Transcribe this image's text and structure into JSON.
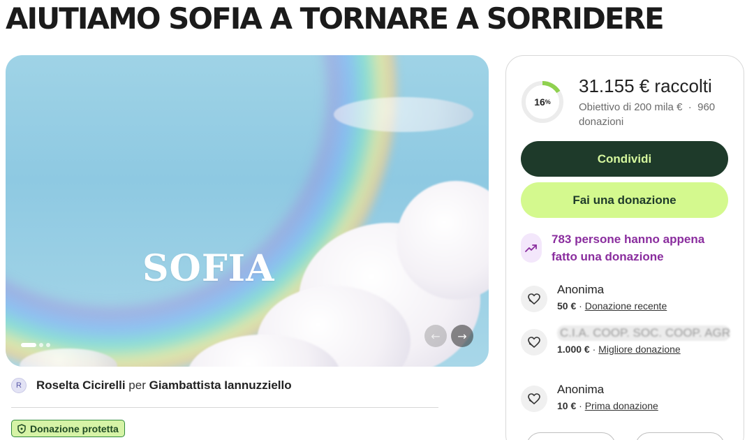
{
  "page": {
    "title": "AIUTIAMO SOFIA A TORNARE A SORRIDERE"
  },
  "hero": {
    "image_text": "SOFIA",
    "slide_count": 3,
    "active_slide": 1,
    "prev_icon": "arrow-left-icon",
    "next_icon": "arrow-right-icon",
    "prev_glyph": "←",
    "next_glyph": "→"
  },
  "organizer": {
    "avatar_initial": "R",
    "organizer_name": "Roselta Cicirelli",
    "connector": "per",
    "beneficiary_name": "Giambattista Iannuzziello"
  },
  "protection": {
    "label": "Donazione protetta",
    "icon": "shield-icon"
  },
  "donation_card": {
    "progress_percent": 16,
    "progress_label": "16",
    "progress_suffix": "%",
    "raised": "31.155 € raccolti",
    "goal": "Obiettivo di 200 mila €",
    "separator": "·",
    "donations_count": "960 donazioni",
    "share_label": "Condividi",
    "donate_label": "Fai una donazione",
    "trend_icon": "trending-up-icon",
    "trend_text": "783 persone hanno appena fatto una donazione",
    "colors": {
      "dark_green": "#1e3a2a",
      "lime": "#d4f98e",
      "purple": "#8a2d9e",
      "progress": "#8fd14f"
    },
    "donors": [
      {
        "name": "Anonima",
        "amount": "50 €",
        "sep": "·",
        "tag": "Donazione recente",
        "icon": "heart-hand-icon"
      },
      {
        "name": "C.I.A. COOP. SOC. COOP. AGRICOLA",
        "amount": "1.000 €",
        "sep": "·",
        "tag": "Migliore donazione",
        "icon": "heart-hand-icon"
      },
      {
        "name": "Anonima",
        "amount": "10 €",
        "sep": "·",
        "tag": "Prima donazione",
        "icon": "heart-hand-icon"
      }
    ]
  }
}
